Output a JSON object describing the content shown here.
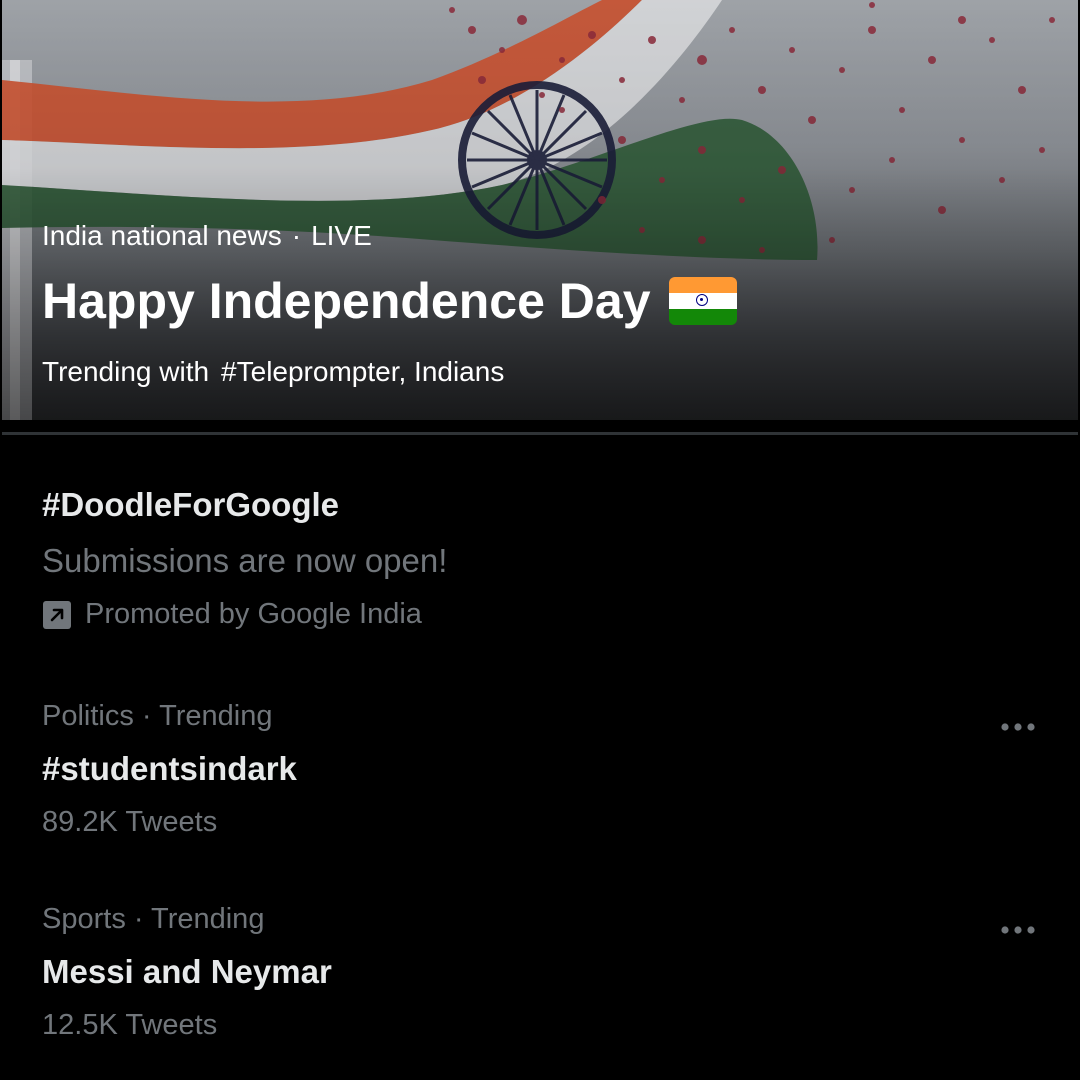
{
  "hero": {
    "category": "India national news",
    "separator": "·",
    "status": "LIVE",
    "title": "Happy Independence Day",
    "trending_prefix": "Trending with",
    "trending_terms": "#Teleprompter, Indians"
  },
  "promoted": {
    "title": "#DoodleForGoogle",
    "description": "Submissions are now open!",
    "promoted_by": "Promoted by Google India",
    "icon": "promoted-arrow-icon"
  },
  "trends": [
    {
      "context": "Politics · Trending",
      "title": "#studentsindark",
      "count": "89.2K Tweets",
      "more_icon": "more-horizontal-icon"
    },
    {
      "context": "Sports · Trending",
      "title": "Messi and Neymar",
      "count": "12.5K Tweets",
      "more_icon": "more-horizontal-icon"
    }
  ],
  "colors": {
    "background": "#000000",
    "primary_text": "#e7e9ea",
    "secondary_text": "#71767b",
    "divider": "#2f3336",
    "flag_saffron": "#ff9933",
    "flag_green": "#138808"
  }
}
